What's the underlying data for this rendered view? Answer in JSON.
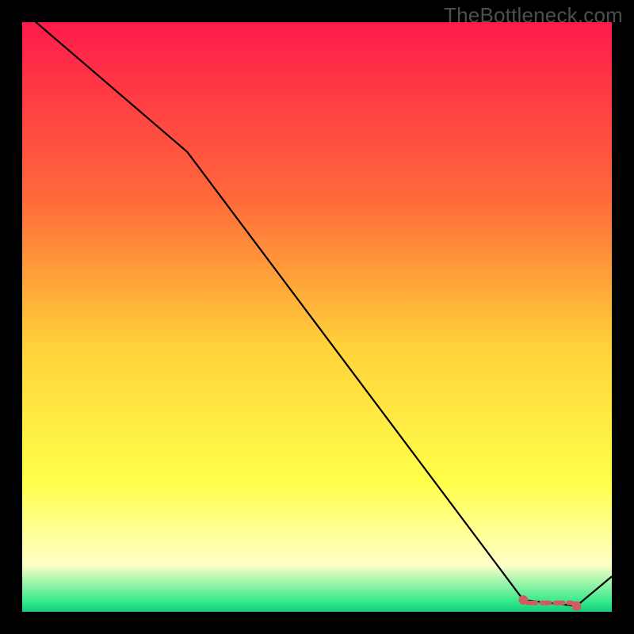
{
  "watermark": "TheBottleneck.com",
  "colors": {
    "page_bg": "#000000",
    "grad_top": "#ff1a4b",
    "grad_mid_upper": "#ff6a3a",
    "grad_mid": "#ffd23a",
    "grad_lower": "#ffff4a",
    "grad_pale": "#ffffc8",
    "grad_green": "#2ee88a",
    "line": "#000000",
    "marker": "#cf5b63"
  },
  "chart_data": {
    "type": "line",
    "title": "",
    "xlabel": "",
    "ylabel": "",
    "xlim": [
      0,
      100
    ],
    "ylim": [
      0,
      100
    ],
    "series": [
      {
        "name": "curve",
        "x": [
          0,
          28,
          85,
          94,
          100
        ],
        "y": [
          102,
          78,
          2,
          1,
          6
        ]
      }
    ],
    "markers": [
      {
        "name": "valley-start",
        "x": 85,
        "y": 2
      },
      {
        "name": "valley-end",
        "x": 94,
        "y": 1
      }
    ],
    "gradient_stops": [
      {
        "offset": 0.0,
        "color": "#ff1a4b"
      },
      {
        "offset": 0.3,
        "color": "#ff6a3a"
      },
      {
        "offset": 0.55,
        "color": "#ffd23a"
      },
      {
        "offset": 0.78,
        "color": "#ffff4a"
      },
      {
        "offset": 0.92,
        "color": "#ffffc8"
      },
      {
        "offset": 0.985,
        "color": "#2ee88a"
      },
      {
        "offset": 1.0,
        "color": "#17c97a"
      }
    ],
    "dash_y": 1.5,
    "dash_x_range": [
      85.8,
      93.2
    ]
  }
}
